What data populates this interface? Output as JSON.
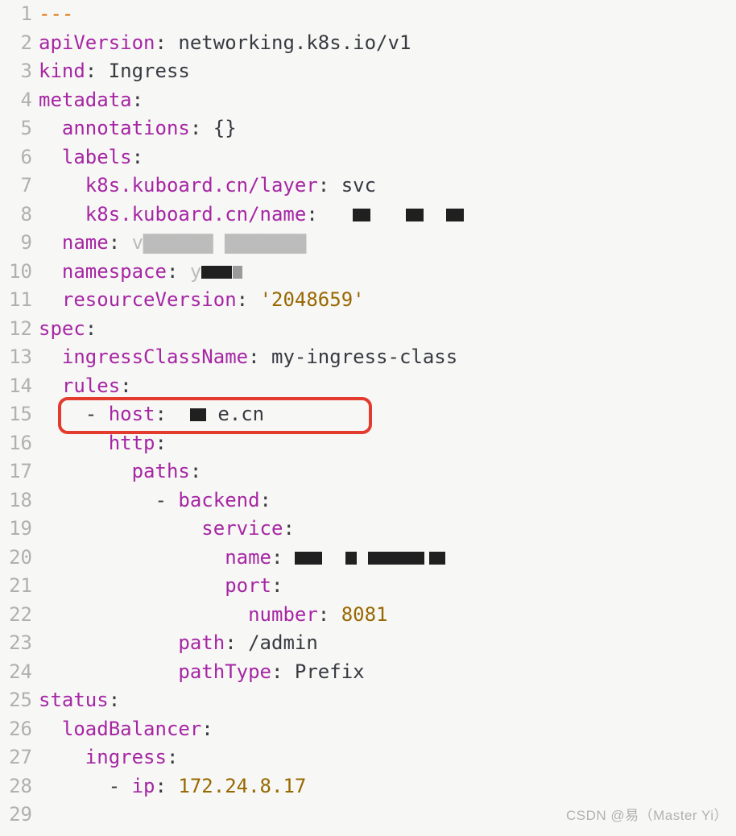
{
  "lines": {
    "l1_dash": "---",
    "l2_k": "apiVersion",
    "l2_v": "networking.k8s.io/v1",
    "l3_k": "kind",
    "l3_v": "Ingress",
    "l4_k": "metadata",
    "l5_k": "annotations",
    "l5_v": "{}",
    "l6_k": "labels",
    "l7_k": "k8s.kuboard.cn/layer",
    "l7_v": "svc",
    "l8_k": "k8s.kuboard.cn/name",
    "l9_k": "name",
    "l10_k": "namespace",
    "l11_k": "resourceVersion",
    "l11_v": "'2048659'",
    "l12_k": "spec",
    "l13_k": "ingressClassName",
    "l13_v": "my-ingress-class",
    "l14_k": "rules",
    "l15_k": "host",
    "l15_v_suffix": "e.cn",
    "l16_k": "http",
    "l17_k": "paths",
    "l18_k": "backend",
    "l19_k": "service",
    "l20_k": "name",
    "l21_k": "port",
    "l22_k": "number",
    "l22_v": "8081",
    "l23_k": "path",
    "l23_v": "/admin",
    "l24_k": "pathType",
    "l24_v": "Prefix",
    "l25_k": "status",
    "l26_k": "loadBalancer",
    "l27_k": "ingress",
    "l28_k": "ip",
    "l28_v": "172.24.8.17"
  },
  "nums": [
    "1",
    "2",
    "3",
    "4",
    "5",
    "6",
    "7",
    "8",
    "9",
    "10",
    "11",
    "12",
    "13",
    "14",
    "15",
    "16",
    "17",
    "18",
    "19",
    "20",
    "21",
    "22",
    "23",
    "24",
    "25",
    "26",
    "27",
    "28",
    "29"
  ],
  "watermark": "CSDN @易（Master Yi）"
}
